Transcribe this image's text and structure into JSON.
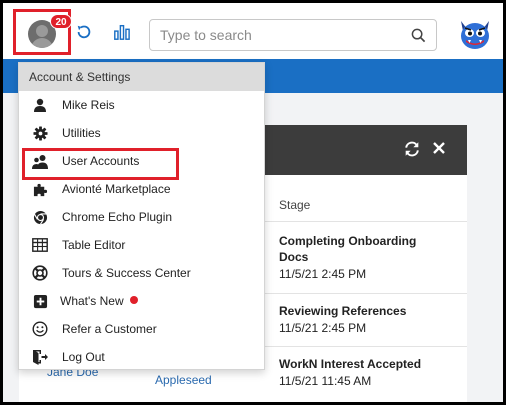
{
  "topbar": {
    "notification_count": "20",
    "search_placeholder": "Type to search"
  },
  "menu": {
    "header": "Account & Settings",
    "items": [
      {
        "label": "Mike Reis",
        "icon": "user-icon"
      },
      {
        "label": "Utilities",
        "icon": "gear-icon"
      },
      {
        "label": "User Accounts",
        "icon": "users-icon"
      },
      {
        "label": "Avionté Marketplace",
        "icon": "puzzle-icon"
      },
      {
        "label": "Chrome Echo Plugin",
        "icon": "chrome-icon"
      },
      {
        "label": "Table Editor",
        "icon": "table-icon"
      },
      {
        "label": "Tours & Success Center",
        "icon": "lifebuoy-icon"
      },
      {
        "label": "What's New",
        "icon": "plus-square-icon"
      },
      {
        "label": "Refer a Customer",
        "icon": "smile-icon"
      },
      {
        "label": "Log Out",
        "icon": "logout-icon"
      }
    ]
  },
  "panel": {
    "column_header": "Stage",
    "rows": [
      {
        "stage": "Completing Onboarding Docs",
        "date": "11/5/21 2:45 PM"
      },
      {
        "stage": "Reviewing References",
        "date": "11/5/21 2:45 PM"
      },
      {
        "stage": "WorkN Interest Accepted",
        "date": "11/5/21 11:45 AM"
      }
    ],
    "bottom_name_1": "Jane Doe",
    "bottom_name_2": "Appleseed"
  },
  "colors": {
    "accent_red": "#e0202a",
    "brand_blue": "#1a6fc4",
    "panel_header": "#3c3c3c"
  }
}
